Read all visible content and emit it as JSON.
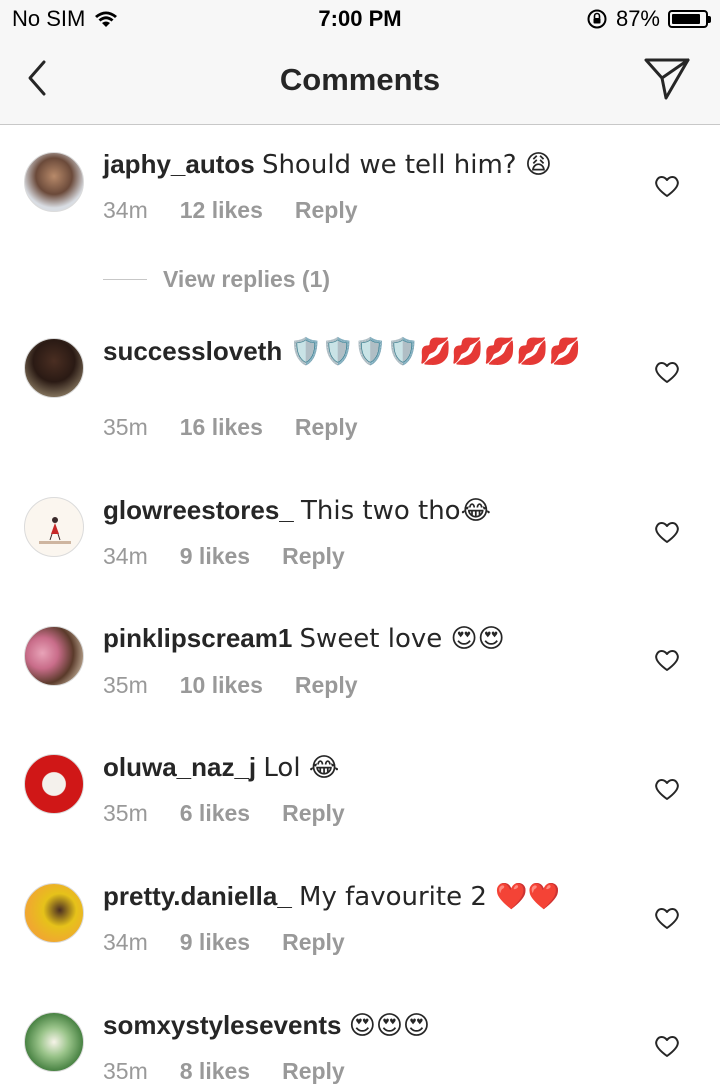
{
  "status_bar": {
    "carrier": "No SIM",
    "time": "7:00 PM",
    "battery": "87%",
    "battery_level": 0.87
  },
  "header": {
    "title": "Comments"
  },
  "colors": {
    "text": "#262626",
    "meta": "#999999",
    "background": "#ffffff",
    "bar": "#f7f7f7"
  },
  "comments": [
    {
      "username": "japhy_autos",
      "text": "Should we tell him? 😩",
      "time": "34m",
      "likes": "12 likes",
      "reply": "Reply",
      "view_replies": "View replies (1)"
    },
    {
      "username": "successloveth",
      "text": "🛡️🛡️🛡️🛡️💋💋💋💋💋",
      "time": "35m",
      "likes": "16 likes",
      "reply": "Reply"
    },
    {
      "username": "glowreestores_",
      "text": "This two tho😂",
      "time": "34m",
      "likes": "9 likes",
      "reply": "Reply"
    },
    {
      "username": "pinklipscream1",
      "text": "Sweet love 😍😍",
      "time": "35m",
      "likes": "10 likes",
      "reply": "Reply"
    },
    {
      "username": "oluwa_naz_j",
      "text": "Lol 😂",
      "time": "35m",
      "likes": "6 likes",
      "reply": "Reply"
    },
    {
      "username": "pretty.daniella_",
      "text": "My favourite 2 ❤️❤️",
      "time": "34m",
      "likes": "9 likes",
      "reply": "Reply"
    },
    {
      "username": "somxystylesevents",
      "text": "😍😍😍",
      "time": "35m",
      "likes": "8 likes",
      "reply": "Reply"
    }
  ]
}
